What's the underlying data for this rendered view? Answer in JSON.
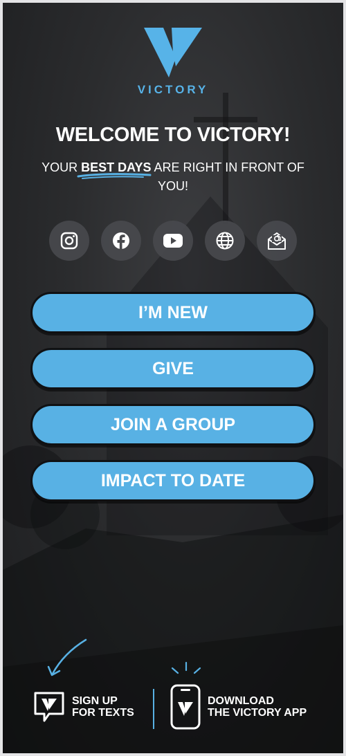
{
  "logo": {
    "word": "VICTORY",
    "icon": "victory-v-logo"
  },
  "welcome": {
    "title": "WELCOME TO VICTORY!"
  },
  "tagline": {
    "before": "YOUR ",
    "highlight": "BEST DAYS",
    "after": " ARE RIGHT IN FRONT OF YOU!"
  },
  "socials": [
    {
      "name": "instagram",
      "icon": "instagram-icon"
    },
    {
      "name": "facebook",
      "icon": "facebook-icon"
    },
    {
      "name": "youtube",
      "icon": "youtube-icon"
    },
    {
      "name": "website",
      "icon": "globe-icon"
    },
    {
      "name": "email",
      "icon": "email-icon"
    }
  ],
  "buttons": [
    {
      "label": "I’M NEW"
    },
    {
      "label": "GIVE"
    },
    {
      "label": "JOIN A GROUP"
    },
    {
      "label": "IMPACT TO DATE"
    }
  ],
  "bottom": {
    "texts": {
      "line1": "SIGN UP",
      "line2": "FOR TEXTS"
    },
    "app": {
      "line1": "DOWNLOAD",
      "line2": "THE VICTORY APP"
    }
  },
  "colors": {
    "accent": "#58b1e4",
    "background": "#2b2c2e",
    "text": "#ffffff"
  }
}
